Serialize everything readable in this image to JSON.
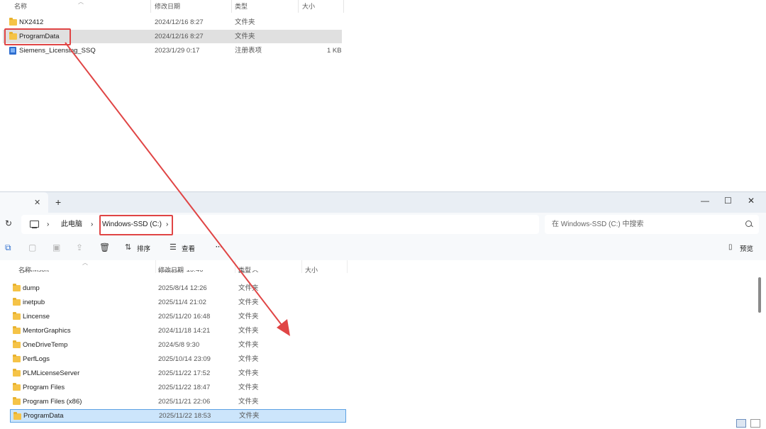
{
  "top_list": {
    "headers": {
      "name": "名称",
      "modified": "修改日期",
      "type": "类型",
      "size": "大小"
    },
    "rows": [
      {
        "name": "NX2412",
        "modified": "2024/12/16 8:27",
        "type": "文件夹",
        "size": "",
        "icon": "folder-icon",
        "selected": false
      },
      {
        "name": "ProgramData",
        "modified": "2024/12/16 8:27",
        "type": "文件夹",
        "size": "",
        "icon": "folder-icon",
        "selected": true
      },
      {
        "name": "Siemens_Licensing_SSQ",
        "modified": "2023/1/29 0:17",
        "type": "注册表项",
        "size": "1 KB",
        "icon": "registry-file-icon",
        "selected": false
      }
    ]
  },
  "window": {
    "tab": {
      "close": "✕",
      "add": "+"
    },
    "controls": {
      "minimize": "—",
      "maximize": "☐",
      "close": "✕"
    },
    "address": {
      "this_pc": "此电脑",
      "drive": "Windows-SSD (C:)",
      "sep": "›"
    },
    "search": {
      "placeholder": "在 Windows-SSD (C:) 中搜索"
    },
    "toolbar": {
      "sort": "排序",
      "view": "查看",
      "more": "···",
      "preview": "预览"
    },
    "headers": {
      "name": "名称",
      "modified": "修改日期",
      "type": "类型",
      "size": "大小"
    },
    "partial_row": {
      "name": "DRMsoft",
      "modified": "2025/6/7 15:46",
      "type": "文件夹"
    },
    "rows": [
      {
        "name": "dump",
        "modified": "2025/8/14 12:26",
        "type": "文件夹",
        "selected": false
      },
      {
        "name": "inetpub",
        "modified": "2025/11/4 21:02",
        "type": "文件夹",
        "selected": false
      },
      {
        "name": "Lincense",
        "modified": "2025/11/20 16:48",
        "type": "文件夹",
        "selected": false
      },
      {
        "name": "MentorGraphics",
        "modified": "2024/11/18 14:21",
        "type": "文件夹",
        "selected": false
      },
      {
        "name": "OneDriveTemp",
        "modified": "2024/5/8 9:30",
        "type": "文件夹",
        "selected": false
      },
      {
        "name": "PerfLogs",
        "modified": "2025/10/14 23:09",
        "type": "文件夹",
        "selected": false
      },
      {
        "name": "PLMLicenseServer",
        "modified": "2025/11/22 17:52",
        "type": "文件夹",
        "selected": false
      },
      {
        "name": "Program Files",
        "modified": "2025/11/22 18:47",
        "type": "文件夹",
        "selected": false
      },
      {
        "name": "Program Files (x86)",
        "modified": "2025/11/21 22:06",
        "type": "文件夹",
        "selected": false
      },
      {
        "name": "ProgramData",
        "modified": "2025/11/22 18:53",
        "type": "文件夹",
        "selected": true
      }
    ]
  },
  "colors": {
    "annotation": "#e04545",
    "selection": "#cce5fb",
    "folder": "#f5c347"
  }
}
